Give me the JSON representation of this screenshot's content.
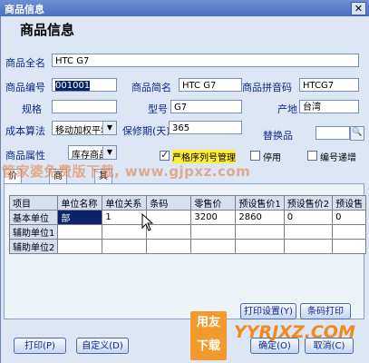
{
  "window": {
    "title": "商品信息",
    "close_label": "✕"
  },
  "heading": "商品信息",
  "fields": {
    "full_name": {
      "label": "商品全名",
      "value": "HTC G7"
    },
    "code": {
      "label": "商品编号",
      "value": "001001"
    },
    "short_name": {
      "label": "商品简名",
      "value": "HTC G7"
    },
    "pinyin": {
      "label": "商品拼音码",
      "value": "HTCG7"
    },
    "spec": {
      "label": "规格",
      "value": ""
    },
    "model": {
      "label": "型号",
      "value": "G7"
    },
    "origin": {
      "label": "产地",
      "value": "台湾"
    },
    "cost_method": {
      "label": "成本算法",
      "value": "移动加权平均"
    },
    "shelf_life": {
      "label": "保修期(天)",
      "value": "365"
    },
    "substitute": {
      "label": "替换品",
      "value": ""
    },
    "attribute": {
      "label": "商品属性",
      "value": "库存商品"
    }
  },
  "checkboxes": {
    "serial_mgmt": {
      "label": "严格序列号管理",
      "checked": true
    },
    "disabled": {
      "label": "停用",
      "checked": false
    },
    "code_increment": {
      "label": "编号递增",
      "checked": false
    }
  },
  "tabs": [
    "价格信息",
    "商品照片",
    "其它信息"
  ],
  "grid": {
    "headers": [
      "项目",
      "单位名称",
      "单位关系",
      "条码",
      "零售价",
      "预设售价1",
      "预设售价2",
      "预设售"
    ],
    "rows": [
      [
        "基本单位",
        "部",
        "1",
        "",
        "3200",
        "2860",
        "0",
        "0"
      ],
      [
        "辅助单位1",
        "",
        "",
        "",
        "",
        "",
        "",
        ""
      ],
      [
        "辅助单位2",
        "",
        "",
        "",
        "",
        "",
        "",
        ""
      ]
    ]
  },
  "buttons": {
    "print_settings": "打印设置(Y)",
    "barcode_print": "条码打印",
    "print": "打印(P)",
    "customize": "自定义(D)",
    "ok": "确定(O)",
    "cancel": "取消(C)"
  },
  "watermark": "管家婆免费版下载, www.gjpxz.com",
  "logo": {
    "line1": "用友",
    "line2": "下载",
    "site": "YYRJXZ.COM"
  },
  "icons": {
    "search": "magnifier-icon",
    "dropdown": "chevron-down-icon",
    "close": "close-icon"
  }
}
